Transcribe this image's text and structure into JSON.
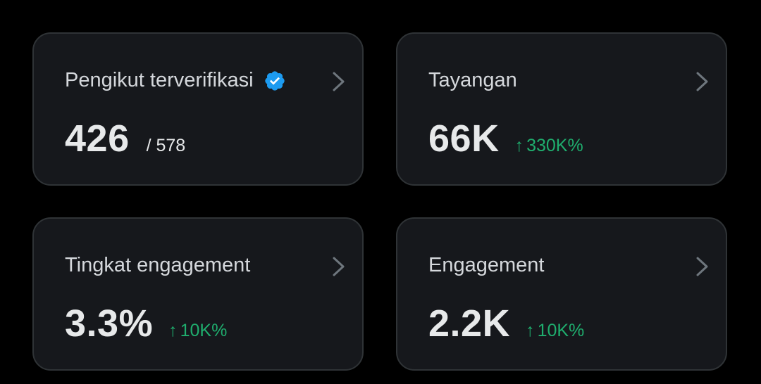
{
  "cards": [
    {
      "title": "Pengikut terverifikasi",
      "value": "426",
      "secondary": "/ 578",
      "verified": true
    },
    {
      "title": "Tayangan",
      "value": "66K",
      "delta_arrow": "↑",
      "delta": "330K%"
    },
    {
      "title": "Tingkat engagement",
      "value": "3.3%",
      "delta_arrow": "↑",
      "delta": "10K%"
    },
    {
      "title": "Engagement",
      "value": "2.2K",
      "delta_arrow": "↑",
      "delta": "10K%"
    }
  ],
  "colors": {
    "background": "#000000",
    "card_background": "#16181c",
    "card_border": "#2f3336",
    "title_text": "#d5d8dc",
    "value_text": "#e7e9ea",
    "positive_delta": "#1fae6e",
    "verified_badge": "#1d9bf0"
  },
  "icons": {
    "verified": "verified-badge-icon",
    "chevron": "chevron-right-icon",
    "arrow": "arrow-up-icon"
  }
}
